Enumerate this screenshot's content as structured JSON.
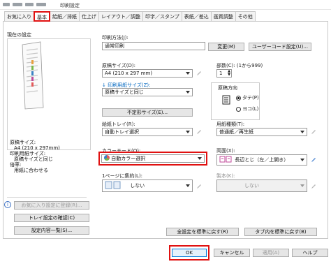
{
  "window": {
    "title": "印刷設定"
  },
  "tabs": [
    "お気に入り",
    "基本",
    "給紙／排紙",
    "仕上げ",
    "レイアウト／調整",
    "印字／スタンプ",
    "表紙／差込",
    "画質調整",
    "その他"
  ],
  "preview": {
    "heading": "現在の設定",
    "info": [
      "原稿サイズ:",
      "A4 (210 x 297mm)",
      "印刷用紙サイズ:",
      "原稿サイズと同じ",
      "倍率:",
      "用紙に合わせる"
    ],
    "favorite_button": "お気に入り設定に登録(R)...",
    "confirm_button": "トレイ設定の確認(C)",
    "list_button": "設定内容一覧(S)..."
  },
  "print_method": {
    "label": "印刷方法(J):",
    "value": "通常印刷",
    "change_button": "変更(M)",
    "user_code_button": "ユーザーコード設定(U)..."
  },
  "original_size": {
    "label": "原稿サイズ(D):",
    "value": "A4 (210 x 297 mm)"
  },
  "copies": {
    "label": "部数(C): (1から999)",
    "value": "1"
  },
  "paper_size": {
    "label": "印刷用紙サイズ(Z):",
    "value": "原稿サイズと同じ"
  },
  "orientation": {
    "label": "原稿方向",
    "portrait": "タテ(P)",
    "landscape": "ヨコ(L)",
    "selected": "portrait"
  },
  "custom_size_button": "不定形サイズ(E)...",
  "tray": {
    "label": "給紙トレイ(R):",
    "value": "自動トレイ選択"
  },
  "paper_type": {
    "label": "用紙種類(T):",
    "value": "普通紙／再生紙"
  },
  "color_mode": {
    "label": "カラーモード(O):",
    "value": "自動カラー選択"
  },
  "duplex": {
    "label": "両面(X):",
    "value": "長辺とじ（左／上開き）"
  },
  "nup": {
    "label": "1ページに集約(L):",
    "value": "しない"
  },
  "booklet": {
    "label": "製本(K):",
    "value": "しない"
  },
  "reset_all_button": "全設定を標準に戻す(R)",
  "reset_tab_button": "タブ内を標準に戻す(B)",
  "footer": {
    "ok": "OK",
    "cancel": "キャンセル",
    "apply": "適用(A)",
    "help": "ヘルプ"
  },
  "colors": {
    "highlight": "#e01111",
    "accent": "#0078d7"
  }
}
